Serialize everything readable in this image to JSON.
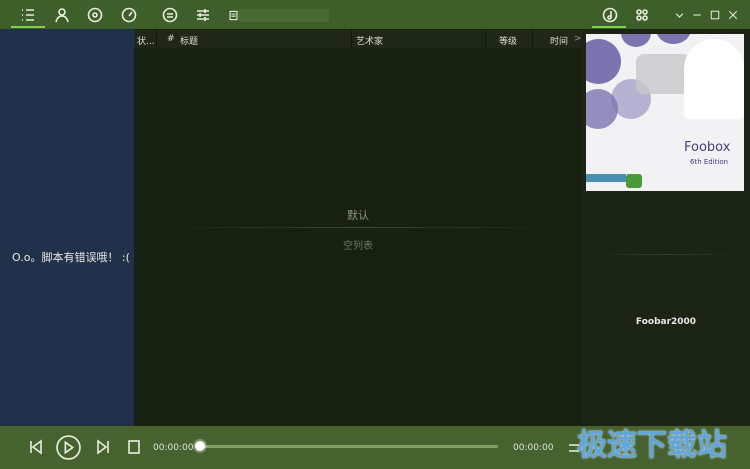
{
  "toolbar": {
    "icons": [
      "playlist-icon",
      "artist-icon",
      "album-icon",
      "dashboard-icon",
      "menu-icon",
      "equalizer-icon"
    ],
    "right_icons": [
      "music-note-icon",
      "apps-icon"
    ]
  },
  "window": {
    "buttons": [
      "chevron-down",
      "minimize",
      "maximize",
      "close"
    ]
  },
  "left_panel": {
    "error": "O.o。脚本有错误哦！ :("
  },
  "playlist": {
    "columns": [
      "状...",
      "#",
      "标题",
      "艺术家",
      "等级",
      "时间",
      ">"
    ],
    "group": "默认",
    "empty": "空列表"
  },
  "right_panel": {
    "cover_title": "Foobox",
    "cover_subtitle": "6th Edition",
    "app_name": "Foobar2000"
  },
  "player": {
    "elapsed": "00:00:00",
    "total": "00:00:00",
    "progress": 0
  },
  "watermark": "极速下载站",
  "colors": {
    "accent": "#7fd14a",
    "topbar": "#3e5e2a",
    "left": "#22314a"
  }
}
